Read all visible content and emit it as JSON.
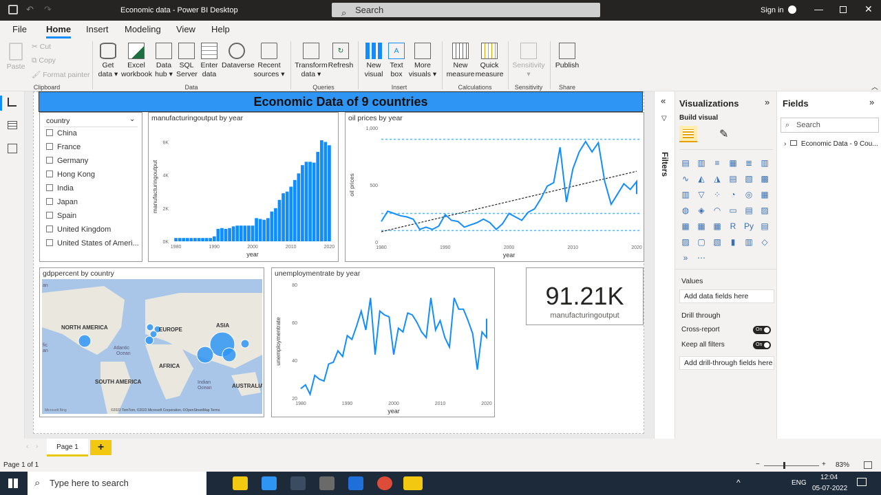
{
  "window": {
    "title": "Economic data - Power BI Desktop",
    "search_placeholder": "Search",
    "sign_in": "Sign in"
  },
  "menu": {
    "file": "File",
    "home": "Home",
    "insert": "Insert",
    "modeling": "Modeling",
    "view": "View",
    "help": "Help"
  },
  "ribbon": {
    "clipboard": {
      "paste": "Paste",
      "cut": "Cut",
      "copy": "Copy",
      "format_painter": "Format painter",
      "group": "Clipboard"
    },
    "data": {
      "get_data_1": "Get",
      "get_data_2": "data",
      "excel_1": "Excel",
      "excel_2": "workbook",
      "hub_1": "Data",
      "hub_2": "hub",
      "sql_1": "SQL",
      "sql_2": "Server",
      "enter_1": "Enter",
      "enter_2": "data",
      "dataverse": "Dataverse",
      "recent_1": "Recent",
      "recent_2": "sources",
      "group": "Data"
    },
    "queries": {
      "transform_1": "Transform",
      "transform_2": "data",
      "refresh": "Refresh",
      "group": "Queries"
    },
    "insert": {
      "new_visual_1": "New",
      "new_visual_2": "visual",
      "text_box_1": "Text",
      "text_box_2": "box",
      "more_1": "More",
      "more_2": "visuals",
      "group": "Insert"
    },
    "calculations": {
      "new_measure_1": "New",
      "new_measure_2": "measure",
      "quick_measure_1": "Quick",
      "quick_measure_2": "measure",
      "group": "Calculations"
    },
    "sensitivity": {
      "label": "Sensitivity",
      "group": "Sensitivity"
    },
    "share": {
      "publish": "Publish",
      "group": "Share"
    }
  },
  "report": {
    "banner": "Economic Data of 9 countries",
    "slicer": {
      "header": "country",
      "items": [
        "China",
        "France",
        "Germany",
        "Hong Kong",
        "India",
        "Japan",
        "Spain",
        "United Kingdom",
        "United States of Ameri..."
      ]
    },
    "map": {
      "title": "gdppercent by country",
      "labels": [
        "NORTH AMERICA",
        "EUROPE",
        "ASIA",
        "AFRICA",
        "SOUTH AMERICA",
        "AUSTRALIA",
        "Atlantic",
        "Ocean",
        "Indian",
        "Ocean",
        "fic",
        "an",
        "an"
      ],
      "copyright": "©2022 TomTom, ©2022 Microsoft Corporation, ©OpenStreetMap  Terms",
      "brand": "Microsoft Bing"
    },
    "card": {
      "value": "91.21K",
      "label": "manufacturingoutput"
    }
  },
  "chart_data": [
    {
      "type": "bar",
      "title": "manufacturingoutput by year",
      "xlabel": "year",
      "ylabel": "manufacturingoutput",
      "xticks": [
        "1980",
        "1990",
        "2000",
        "2010",
        "2020"
      ],
      "yticks": [
        "0K",
        "2K",
        "4K",
        "6K"
      ],
      "ylim": [
        0,
        6600
      ],
      "categories": [
        1980,
        1981,
        1982,
        1983,
        1984,
        1985,
        1986,
        1987,
        1988,
        1989,
        1990,
        1991,
        1992,
        1993,
        1994,
        1995,
        1996,
        1997,
        1998,
        1999,
        2000,
        2001,
        2002,
        2003,
        2004,
        2005,
        2006,
        2007,
        2008,
        2009,
        2010,
        2011,
        2012,
        2013,
        2014,
        2015,
        2016,
        2017,
        2018,
        2019,
        2020
      ],
      "values": [
        200,
        200,
        200,
        200,
        200,
        200,
        200,
        200,
        200,
        200,
        300,
        750,
        800,
        750,
        800,
        900,
        950,
        950,
        950,
        950,
        950,
        1400,
        1350,
        1300,
        1400,
        1800,
        2000,
        2500,
        2900,
        3000,
        3300,
        3700,
        4100,
        4600,
        4800,
        4800,
        4750,
        5400,
        6100,
        6000,
        5800
      ]
    },
    {
      "type": "line",
      "title": "oil prices by year",
      "xlabel": "year",
      "ylabel": "oil prices",
      "xticks": [
        "1980",
        "1990",
        "2000",
        "2010",
        "2020"
      ],
      "yticks": [
        "0",
        "500",
        "1,000"
      ],
      "ylim": [
        0,
        1000
      ],
      "reference_lines": [
        900,
        250,
        100
      ],
      "trend": {
        "start": [
          1980,
          90
        ],
        "end": [
          2020,
          620
        ]
      },
      "series": [
        {
          "values": [
            [
              1980,
              180
            ],
            [
              1981,
              270
            ],
            [
              1982,
              250
            ],
            [
              1983,
              230
            ],
            [
              1984,
              220
            ],
            [
              1985,
              200
            ],
            [
              1986,
              110
            ],
            [
              1987,
              130
            ],
            [
              1988,
              110
            ],
            [
              1989,
              140
            ],
            [
              1990,
              240
            ],
            [
              1991,
              190
            ],
            [
              1992,
              180
            ],
            [
              1993,
              130
            ],
            [
              1994,
              150
            ],
            [
              1995,
              170
            ],
            [
              1996,
              200
            ],
            [
              1997,
              170
            ],
            [
              1998,
              110
            ],
            [
              1999,
              160
            ],
            [
              2000,
              250
            ],
            [
              2001,
              220
            ],
            [
              2002,
              190
            ],
            [
              2003,
              260
            ],
            [
              2004,
              290
            ],
            [
              2005,
              380
            ],
            [
              2006,
              490
            ],
            [
              2007,
              520
            ],
            [
              2008,
              830
            ],
            [
              2009,
              350
            ],
            [
              2010,
              640
            ],
            [
              2011,
              790
            ],
            [
              2012,
              880
            ],
            [
              2013,
              790
            ],
            [
              2014,
              870
            ],
            [
              2015,
              530
            ],
            [
              2016,
              330
            ],
            [
              2017,
              420
            ],
            [
              2018,
              510
            ],
            [
              2019,
              460
            ],
            [
              2020,
              530
            ],
            [
              2021,
              420
            ]
          ]
        }
      ]
    },
    {
      "type": "line",
      "title": "unemploymentrate by year",
      "xlabel": "year",
      "ylabel": "unemploymentrate",
      "xticks": [
        "1980",
        "1990",
        "2000",
        "2010",
        "2020"
      ],
      "yticks": [
        "20",
        "40",
        "60",
        "80"
      ],
      "ylim": [
        20,
        80
      ],
      "series": [
        {
          "values": [
            [
              1980,
              25
            ],
            [
              1981,
              27
            ],
            [
              1982,
              22
            ],
            [
              1983,
              32
            ],
            [
              1984,
              30
            ],
            [
              1985,
              29
            ],
            [
              1986,
              38
            ],
            [
              1987,
              39
            ],
            [
              1988,
              45
            ],
            [
              1989,
              42
            ],
            [
              1990,
              53
            ],
            [
              1991,
              51
            ],
            [
              1992,
              58
            ],
            [
              1993,
              66
            ],
            [
              1994,
              56
            ],
            [
              1995,
              73
            ],
            [
              1996,
              43
            ],
            [
              1997,
              66
            ],
            [
              1998,
              64
            ],
            [
              1999,
              63
            ],
            [
              2000,
              43
            ],
            [
              2001,
              57
            ],
            [
              2002,
              55
            ],
            [
              2003,
              65
            ],
            [
              2004,
              64
            ],
            [
              2005,
              60
            ],
            [
              2006,
              55
            ],
            [
              2007,
              52
            ],
            [
              2008,
              73
            ],
            [
              2009,
              56
            ],
            [
              2010,
              61
            ],
            [
              2011,
              52
            ],
            [
              2012,
              47
            ],
            [
              2013,
              73
            ],
            [
              2014,
              67
            ],
            [
              2015,
              67
            ],
            [
              2016,
              61
            ],
            [
              2017,
              54
            ],
            [
              2018,
              35
            ],
            [
              2019,
              55
            ],
            [
              2020,
              52
            ],
            [
              2021,
              62
            ]
          ]
        }
      ]
    }
  ],
  "panes": {
    "filters": "Filters",
    "visualizations": {
      "title": "Visualizations",
      "build": "Build visual",
      "values": "Values",
      "add_data": "Add data fields here",
      "drill": "Drill through",
      "cross_report": "Cross-report",
      "keep_filters": "Keep all filters",
      "toggle_on": "On",
      "add_drill": "Add drill-through fields here"
    },
    "fields": {
      "title": "Fields",
      "search_placeholder": "Search",
      "table": "Economic Data - 9 Cou..."
    }
  },
  "pages": {
    "tab": "Page 1",
    "status": "Page 1 of 1",
    "zoom": "83%"
  },
  "taskbar": {
    "search": "Type here to search",
    "lang": "ENG",
    "time": "12:04",
    "date": "05-07-2022"
  },
  "colors": {
    "accent": "#118dff",
    "banner": "#2f95f5",
    "bar": "#118dff",
    "ref_line": "#5db3f0"
  }
}
